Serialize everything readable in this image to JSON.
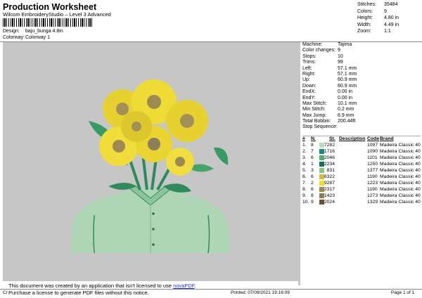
{
  "header": {
    "title": "Production Worksheet",
    "software": "Wilcom EmbroideryStudio – Level 3 Advanced",
    "design_label": "Design:",
    "design_value": "baju_bunga 4.8in",
    "colorway_label": "Colorway:",
    "colorway_value": "Colorway 1"
  },
  "stats": [
    {
      "label": "Stitches:",
      "value": "35484"
    },
    {
      "label": "Colors:",
      "value": "9"
    },
    {
      "label": "Height:",
      "value": "4.80 in"
    },
    {
      "label": "Width:",
      "value": "4.49 in"
    },
    {
      "label": "Zoom:",
      "value": "1:1"
    }
  ],
  "machine_info": [
    {
      "label": "Machine:",
      "value": "Tajima"
    },
    {
      "label": "Color changes:",
      "value": "9"
    },
    {
      "label": "Stops:",
      "value": "10"
    },
    {
      "label": "Trims:",
      "value": "99"
    },
    {
      "label": "Left:",
      "value": "57.1 mm"
    },
    {
      "label": "Right:",
      "value": "57.1 mm"
    },
    {
      "label": "Up:",
      "value": "60.9 mm"
    },
    {
      "label": "Down:",
      "value": "60.9 mm"
    },
    {
      "label": "EndX:",
      "value": "0.00 in"
    },
    {
      "label": "EndY:",
      "value": "0.00 in"
    },
    {
      "label": "Max Stitch:",
      "value": "10.1 mm"
    },
    {
      "label": "Min Stitch:",
      "value": "0.2 mm"
    },
    {
      "label": "Max Jump:",
      "value": "6.9 mm"
    },
    {
      "label": "Total Bobbin:",
      "value": "200.44ft"
    }
  ],
  "stop_sequence": {
    "title": "Stop Sequence:",
    "headers": {
      "num": "#",
      "n": "N.",
      "st": "St.",
      "description": "Description",
      "code": "Code",
      "brand": "Brand"
    },
    "rows": [
      {
        "num": "1.",
        "n": "8",
        "color": "#b9dcc3",
        "st": "7282",
        "description": "",
        "code": "1097",
        "brand": "Madeira Classic 40"
      },
      {
        "num": "2.",
        "n": "7",
        "color": "#1a8a7a",
        "st": "1716",
        "description": "",
        "code": "1090",
        "brand": "Madeira Classic 40"
      },
      {
        "num": "3.",
        "n": "6",
        "color": "#4fae70",
        "st": "2046",
        "description": "",
        "code": "1101",
        "brand": "Madeira Classic 40"
      },
      {
        "num": "4.",
        "n": "1",
        "color": "#177055",
        "st": "2234",
        "description": "",
        "code": "1250",
        "brand": "Madeira Classic 40"
      },
      {
        "num": "5.",
        "n": "3",
        "color": "#8ac68c",
        "st": "831",
        "description": "",
        "code": "1377",
        "brand": "Madeira Classic 40"
      },
      {
        "num": "6.",
        "n": "6",
        "color": "#cfbf3a",
        "st": "6322",
        "description": "",
        "code": "1190",
        "brand": "Madeira Classic 40"
      },
      {
        "num": "7.",
        "n": "2",
        "color": "#f2dc2c",
        "st": "9287",
        "description": "",
        "code": "1223",
        "brand": "Madeira Classic 40"
      },
      {
        "num": "8.",
        "n": "6",
        "color": "#9c8a55",
        "st": "2317",
        "description": "",
        "code": "1190",
        "brand": "Madeira Classic 40"
      },
      {
        "num": "9.",
        "n": "8",
        "color": "#8b7f5a",
        "st": "1423",
        "description": "",
        "code": "1273",
        "brand": "Madeira Classic 40"
      },
      {
        "num": "10.",
        "n": "9",
        "color": "#6b5038",
        "st": "2024",
        "description": "",
        "code": "1329",
        "brand": "Madeira Classic 40"
      }
    ]
  },
  "notice": {
    "line1_text": "This document was created by an application that isn't licensed to use ",
    "link_text": "novaPDF",
    "line2_text": "Purchase a license to generate PDF files without this notice."
  },
  "footer": {
    "left": "Cr",
    "printed": "Printed: 07/09/2021 19:16:09",
    "page": "Page 1 of 1"
  }
}
